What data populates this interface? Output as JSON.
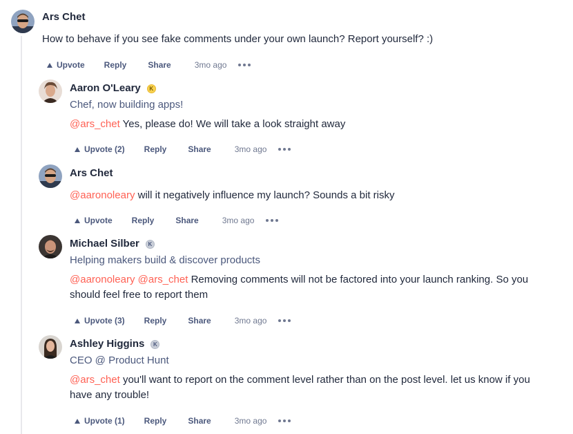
{
  "comments": [
    {
      "author": "Ars Chet",
      "badge": "",
      "headline": "",
      "mentions": [],
      "text": "How to behave if you see fake comments under your own launch? Report yourself? :)",
      "upvote": "Upvote",
      "reply": "Reply",
      "share": "Share",
      "time": "3mo ago"
    },
    {
      "author": "Aaron O'Leary",
      "badge": "K",
      "headline": "Chef, now building apps!",
      "mentions": [
        "@ars_chet"
      ],
      "text": "Yes, please do! We will take a look straight away",
      "upvote": "Upvote (2)",
      "reply": "Reply",
      "share": "Share",
      "time": "3mo ago"
    },
    {
      "author": "Ars Chet",
      "badge": "",
      "headline": "",
      "mentions": [
        "@aaronoleary"
      ],
      "text": "will it negatively influence my launch? Sounds a bit risky",
      "upvote": "Upvote",
      "reply": "Reply",
      "share": "Share",
      "time": "3mo ago"
    },
    {
      "author": "Michael Silber",
      "badge": "K",
      "headline": "Helping makers build & discover products",
      "mentions": [
        "@aaronoleary",
        "@ars_chet"
      ],
      "text": "Removing comments will not be factored into your launch ranking. So you should feel free to report them",
      "upvote": "Upvote (3)",
      "reply": "Reply",
      "share": "Share",
      "time": "3mo ago"
    },
    {
      "author": "Ashley Higgins",
      "badge": "K",
      "headline": "CEO @ Product Hunt",
      "mentions": [
        "@ars_chet"
      ],
      "text": "you'll want to report on the comment level rather than on the post level. let us know if you have any trouble!",
      "upvote": "Upvote (1)",
      "reply": "Reply",
      "share": "Share",
      "time": "3mo ago"
    }
  ]
}
